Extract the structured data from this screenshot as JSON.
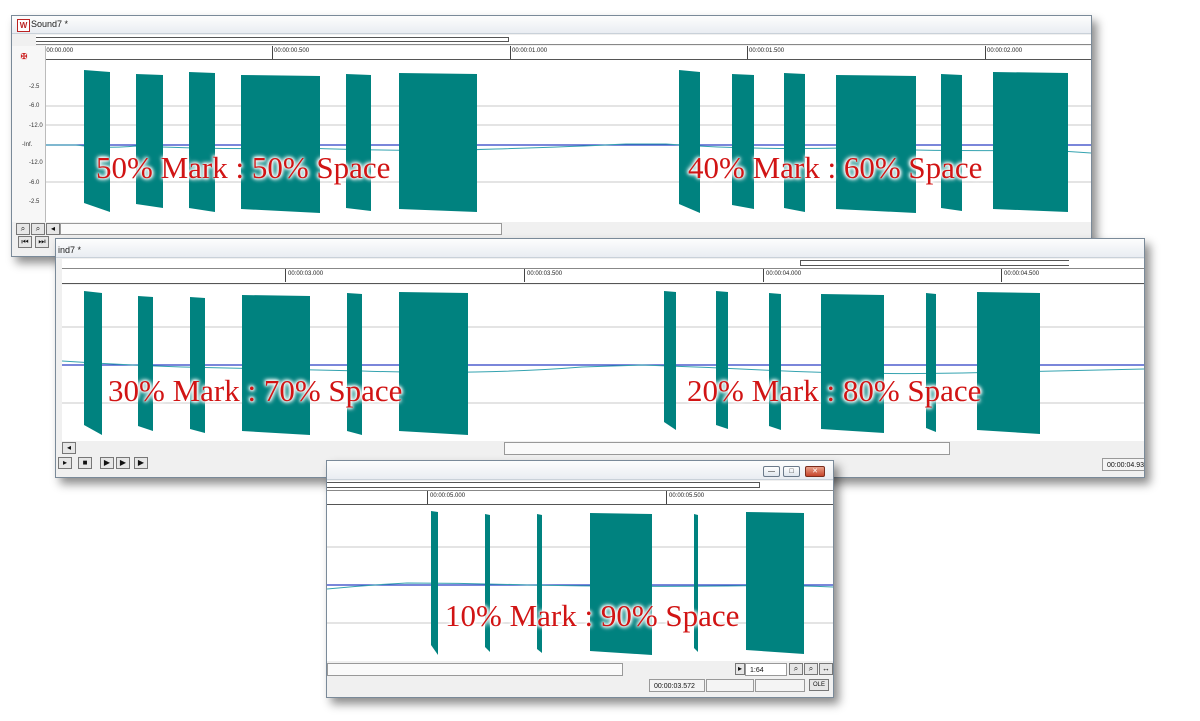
{
  "window1": {
    "title": "Sound7 *",
    "time_labels": [
      "00:00:00.000",
      "00:00:00.500",
      "00:00:01.000",
      "00:00:01.500",
      "00:00:02.000"
    ],
    "db_labels": [
      "-2.5",
      "-6.0",
      "-12.0",
      "-Inf.",
      "-12.0",
      "-6.0",
      "-2.5"
    ],
    "captions": [
      "50% Mark : 50% Space",
      "40% Mark : 60% Space"
    ]
  },
  "window2": {
    "title": "ind7 *",
    "time_labels": [
      "00:00:03.000",
      "00:00:03.500",
      "00:00:04.000",
      "00:00:04.500"
    ],
    "captions": [
      "30% Mark : 70% Space",
      "20% Mark : 80% Space"
    ],
    "status_time": "00:00:04.93"
  },
  "window3": {
    "time_labels": [
      "00:00:05.000",
      "00:00:05.500"
    ],
    "caption": "10% Mark : 90% Space",
    "zoom_level": "1:64",
    "status_time": "00:00:03.572",
    "ole_label": "OLE"
  },
  "colors": {
    "waveform": "#00827f",
    "caption": "#d11414",
    "center_line": "#2a3ec4"
  },
  "icons": {
    "play": "play-icon",
    "stop": "stop-icon",
    "zoom": "magnifier-icon"
  }
}
